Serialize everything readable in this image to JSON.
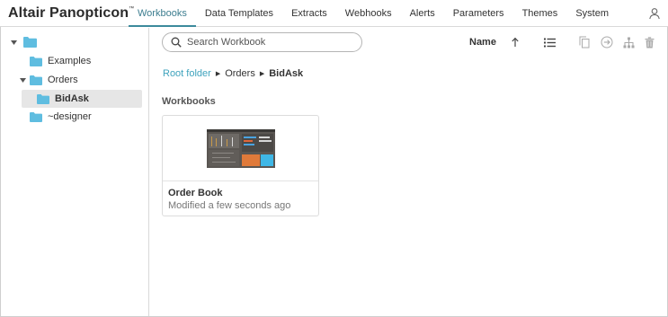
{
  "app": {
    "logo_text": "Altair Panopticon",
    "logo_mark": "™"
  },
  "nav": {
    "tabs": [
      {
        "label": "Workbooks",
        "active": true
      },
      {
        "label": "Data Templates",
        "active": false
      },
      {
        "label": "Extracts",
        "active": false
      },
      {
        "label": "Webhooks",
        "active": false
      },
      {
        "label": "Alerts",
        "active": false
      },
      {
        "label": "Parameters",
        "active": false
      },
      {
        "label": "Themes",
        "active": false
      },
      {
        "label": "System",
        "active": false
      }
    ],
    "user_icon": "user-icon"
  },
  "tree": {
    "root": {
      "label": "",
      "expanded": true
    },
    "items": [
      {
        "label": "Examples",
        "expanded": false,
        "selected": false
      },
      {
        "label": "Orders",
        "expanded": true,
        "selected": false
      },
      {
        "label": "BidAsk",
        "expanded": false,
        "selected": true
      },
      {
        "label": "~designer",
        "expanded": false,
        "selected": false
      }
    ]
  },
  "toolbar": {
    "search_placeholder": "Search Workbook",
    "sort_label": "Name",
    "icons": [
      "sort-ascending-icon",
      "list-view-icon",
      "copy-icon",
      "move-icon",
      "hierarchy-icon",
      "delete-icon"
    ]
  },
  "breadcrumb": {
    "root": "Root folder",
    "parts": [
      "Orders",
      "BidAsk"
    ]
  },
  "section": {
    "title": "Workbooks"
  },
  "workbooks": [
    {
      "name": "Order Book",
      "modified": "Modified a few seconds ago"
    }
  ],
  "colors": {
    "accent": "#3c8a9c",
    "link": "#3fa3bd",
    "folder": "#5fbde0",
    "selected_bg": "#e6e6e6"
  }
}
